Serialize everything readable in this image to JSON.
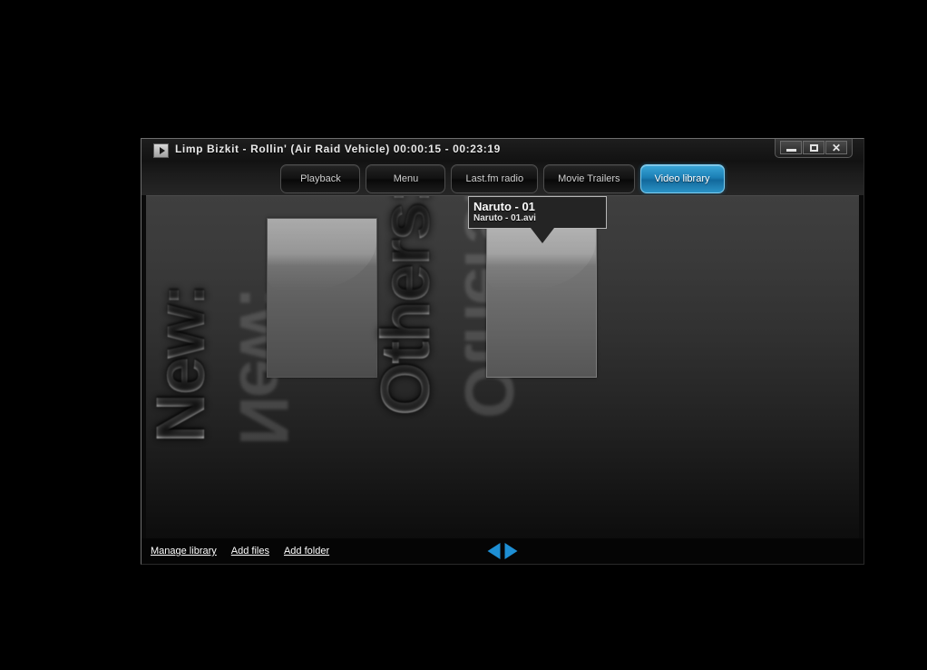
{
  "window": {
    "title": "Limp Bizkit - Rollin' (Air Raid Vehicle)  00:00:15 - 00:23:19",
    "play_icon": "play-icon",
    "controls": {
      "minimize_label": "",
      "maximize_label": "",
      "close_label": "✕"
    }
  },
  "tabs": [
    {
      "label": "Playback",
      "active": false
    },
    {
      "label": "Menu",
      "active": false
    },
    {
      "label": "Last.fm radio",
      "active": false
    },
    {
      "label": "Movie Trailers",
      "active": false
    },
    {
      "label": "Video library",
      "active": true
    }
  ],
  "library": {
    "categories": [
      {
        "label": "New:",
        "thumbnail_hovered": false
      },
      {
        "label": "Others:",
        "thumbnail_hovered": true
      }
    ],
    "tooltip": {
      "title": "Naruto - 01",
      "filename": "Naruto - 01.avi"
    }
  },
  "statusbar": {
    "links": [
      {
        "label": "Manage library"
      },
      {
        "label": "Add files"
      },
      {
        "label": "Add folder"
      }
    ],
    "prev_icon": "arrow-left-icon",
    "next_icon": "arrow-right-icon"
  },
  "colors": {
    "accent_blue": "#1e8fd4",
    "active_tab_blue": "#2b93c6",
    "window_border": "#6e6e6e",
    "content_top": "#3f3f3f",
    "content_bottom": "#0d0d0d"
  }
}
